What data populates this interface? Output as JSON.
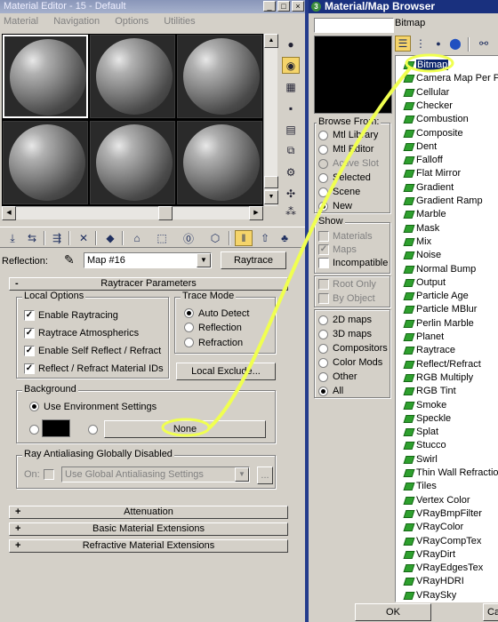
{
  "editor": {
    "title": "Material Editor - 15 - Default",
    "menu": [
      "Material",
      "Navigation",
      "Options",
      "Utilities"
    ],
    "reflection_label": "Reflection:",
    "map_name": "Map #16",
    "map_type_button": "Raytrace"
  },
  "raytracer": {
    "header": "Raytracer Parameters",
    "header_sign": "-",
    "local_options": {
      "title": "Local Options",
      "items": [
        {
          "label": "Enable Raytracing",
          "checked": true
        },
        {
          "label": "Raytrace Atmospherics",
          "checked": true
        },
        {
          "label": "Enable Self Reflect / Refract",
          "checked": true
        },
        {
          "label": "Reflect / Refract Material IDs",
          "checked": true
        }
      ]
    },
    "trace_mode": {
      "title": "Trace Mode",
      "options": [
        {
          "label": "Auto Detect",
          "selected": true
        },
        {
          "label": "Reflection",
          "selected": false
        },
        {
          "label": "Refraction",
          "selected": false
        }
      ]
    },
    "local_exclude_button": "Local Exclude...",
    "background": {
      "title": "Background",
      "use_env_label": "Use Environment Settings",
      "color_swatch": "#000000",
      "map_button": "None"
    },
    "antialias": {
      "title": "Ray Antialiasing Globally Disabled",
      "on_label": "On:",
      "setting": "Use Global Antialiasing Settings",
      "more_button": "..."
    }
  },
  "rollouts": [
    {
      "sign": "+",
      "label": "Attenuation"
    },
    {
      "sign": "+",
      "label": "Basic Material Extensions"
    },
    {
      "sign": "+",
      "label": "Refractive Material Extensions"
    }
  ],
  "browser": {
    "title": "Material/Map Browser",
    "selected_name": "Bitmap",
    "browse_from": {
      "title": "Browse From:",
      "options": [
        {
          "label": "Mtl Library",
          "selected": false,
          "disabled": false
        },
        {
          "label": "Mtl Editor",
          "selected": false,
          "disabled": false
        },
        {
          "label": "Active Slot",
          "selected": false,
          "disabled": true
        },
        {
          "label": "Selected",
          "selected": false,
          "disabled": false
        },
        {
          "label": "Scene",
          "selected": false,
          "disabled": false
        },
        {
          "label": "New",
          "selected": true,
          "disabled": false
        }
      ]
    },
    "show": {
      "title": "Show",
      "options": [
        {
          "label": "Materials",
          "checked": false,
          "disabled": true
        },
        {
          "label": "Maps",
          "checked": true,
          "disabled": true
        },
        {
          "label": "Incompatible",
          "checked": false,
          "disabled": false
        }
      ]
    },
    "object_opts": [
      {
        "label": "Root Only",
        "disabled": true
      },
      {
        "label": "By Object",
        "disabled": true
      }
    ],
    "map_categories": [
      {
        "label": "2D maps",
        "selected": false
      },
      {
        "label": "3D maps",
        "selected": false
      },
      {
        "label": "Compositors",
        "selected": false
      },
      {
        "label": "Color Mods",
        "selected": false
      },
      {
        "label": "Other",
        "selected": false
      },
      {
        "label": "All",
        "selected": true
      }
    ],
    "maps": [
      "Bitmap",
      "Camera Map Per Pixel",
      "Cellular",
      "Checker",
      "Combustion",
      "Composite",
      "Dent",
      "Falloff",
      "Flat Mirror",
      "Gradient",
      "Gradient Ramp",
      "Marble",
      "Mask",
      "Mix",
      "Noise",
      "Normal Bump",
      "Output",
      "Particle Age",
      "Particle MBlur",
      "Perlin Marble",
      "Planet",
      "Raytrace",
      "Reflect/Refract",
      "RGB Multiply",
      "RGB Tint",
      "Smoke",
      "Speckle",
      "Splat",
      "Stucco",
      "Swirl",
      "Thin Wall Refraction",
      "Tiles",
      "Vertex Color",
      "VRayBmpFilter",
      "VRayColor",
      "VRayCompTex",
      "VRayDirt",
      "VRayEdgesTex",
      "VRayHDRI",
      "VRaySky"
    ],
    "ok_button": "OK",
    "cancel_button": "Cancel"
  },
  "annotation_color": "#f0ff50"
}
